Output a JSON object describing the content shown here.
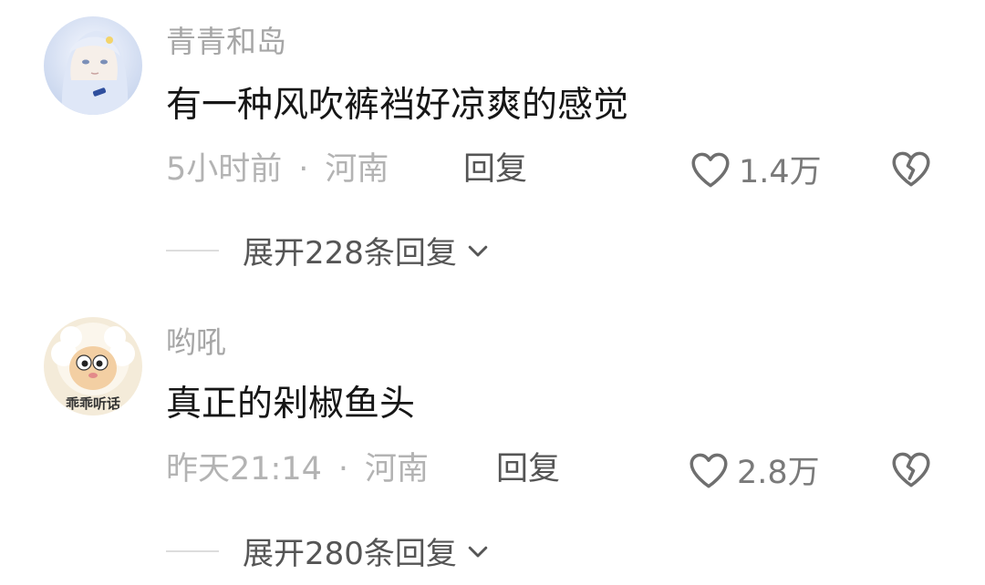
{
  "comments": [
    {
      "username": "青青和岛",
      "content": "有一种风吹裤裆好凉爽的感觉",
      "time": "5小时前",
      "separator": "·",
      "location": "河南",
      "reply_label": "回复",
      "likes": "1.4万",
      "expand_label": "展开228条回复",
      "avatar_text": ""
    },
    {
      "username": "哟吼",
      "content": "真正的剁椒鱼头",
      "time": "昨天21:14",
      "separator": "·",
      "location": "河南",
      "reply_label": "回复",
      "likes": "2.8万",
      "expand_label": "展开280条回复",
      "avatar_text": "乖乖听话"
    }
  ],
  "icons": {
    "like": "heart-outline-icon",
    "dislike": "broken-heart-icon",
    "expand": "chevron-down-icon"
  },
  "colors": {
    "username": "#a6a6a6",
    "content": "#161616",
    "meta": "#b3b3b3",
    "action": "#555555"
  }
}
